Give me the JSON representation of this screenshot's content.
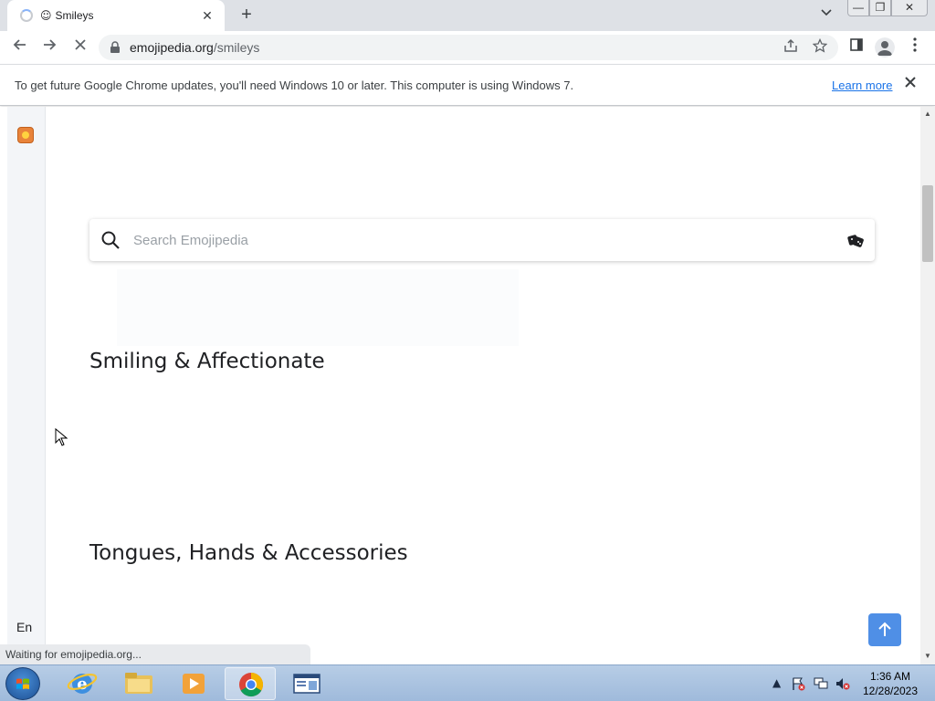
{
  "browser": {
    "tab": {
      "favicon": "☺",
      "title": "Smileys",
      "close": "✕"
    },
    "new_tab": "+",
    "tab_list": "⌄",
    "window": {
      "minimize": "—",
      "maximize": "❐",
      "close": "✕"
    },
    "nav": {
      "back": "←",
      "forward": "→",
      "stop": "✕"
    },
    "url": {
      "host": "emojipedia.org",
      "path": "/smileys"
    },
    "toolbar_icons": {
      "share": "⇪",
      "star": "☆",
      "side_panel": "▯",
      "menu": "⋮"
    }
  },
  "infobar": {
    "message": "To get future Google Chrome updates, you'll need Windows 10 or later. This computer is using Windows 7.",
    "link": "Learn more",
    "close": "✕"
  },
  "page": {
    "language": "En",
    "search_placeholder": "Search Emojipedia",
    "sections": [
      {
        "title": "Smiling & Affectionate"
      },
      {
        "title": "Tongues, Hands & Accessories"
      }
    ]
  },
  "status": {
    "text": "Waiting for emojipedia.org..."
  },
  "taskbar": {
    "time": "1:36 AM",
    "date": "12/28/2023",
    "tray_arrow": "▲"
  },
  "colors": {
    "accent": "#4f8fe6",
    "link": "#1a73e8",
    "tabstrip": "#dee1e6"
  }
}
